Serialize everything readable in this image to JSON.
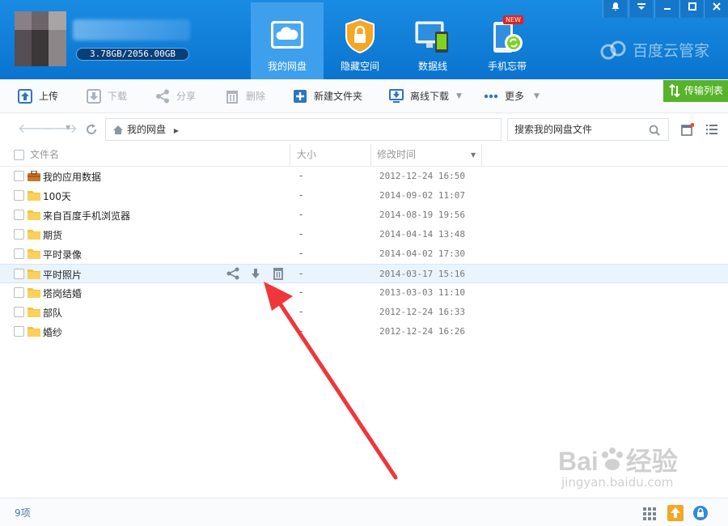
{
  "header": {
    "quota": "3.78GB/2056.00GB",
    "nav": [
      {
        "label": "我的网盘",
        "active": true,
        "icon": "cloud-drive-icon"
      },
      {
        "label": "隐藏空间",
        "active": false,
        "icon": "lock-icon"
      },
      {
        "label": "数据线",
        "active": false,
        "icon": "devices-icon"
      },
      {
        "label": "手机忘带",
        "active": false,
        "icon": "phone-sync-icon",
        "badge": "NEW"
      }
    ],
    "brand": "百度云管家"
  },
  "toolbar": {
    "upload": "上传",
    "download": "下载",
    "share": "分享",
    "delete": "删除",
    "new_folder": "新建文件夹",
    "offline_download": "离线下载",
    "more": "更多",
    "transfer_list": "传输列表"
  },
  "address": {
    "breadcrumb": "我的网盘",
    "search_placeholder": "搜索我的网盘文件"
  },
  "table": {
    "columns": [
      "文件名",
      "大小",
      "修改时间"
    ],
    "rows": [
      {
        "name": "我的应用数据",
        "size": "-",
        "time": "2012-12-24 16:50",
        "type": "app-folder"
      },
      {
        "name": "100天",
        "size": "-",
        "time": "2014-09-02 11:07",
        "type": "folder"
      },
      {
        "name": "来自百度手机浏览器",
        "size": "-",
        "time": "2014-08-19 19:56",
        "type": "folder"
      },
      {
        "name": "期货",
        "size": "-",
        "time": "2014-04-14 13:48",
        "type": "folder"
      },
      {
        "name": "平时录像",
        "size": "-",
        "time": "2014-04-02 17:30",
        "type": "folder"
      },
      {
        "name": "平时照片",
        "size": "-",
        "time": "2014-03-17 15:16",
        "type": "folder",
        "hover": true
      },
      {
        "name": "塔岗结婚",
        "size": "-",
        "time": "2013-03-03 11:10",
        "type": "folder"
      },
      {
        "name": "部队",
        "size": "-",
        "time": "2012-12-24 16:33",
        "type": "folder"
      },
      {
        "name": "婚纱",
        "size": "-",
        "time": "2012-12-24 16:26",
        "type": "folder"
      }
    ]
  },
  "status": {
    "count": "9项"
  },
  "watermark": {
    "logo": "Bai",
    "logo_suffix": "经验",
    "url": "jingyan.baidu.com"
  },
  "colors": {
    "header_blue": "#0a74cf",
    "active_tab": "#3ea0ec",
    "transfer_green": "#57b32a",
    "folder_yellow": "#f6c33c",
    "arrow_red": "#f0363a"
  }
}
